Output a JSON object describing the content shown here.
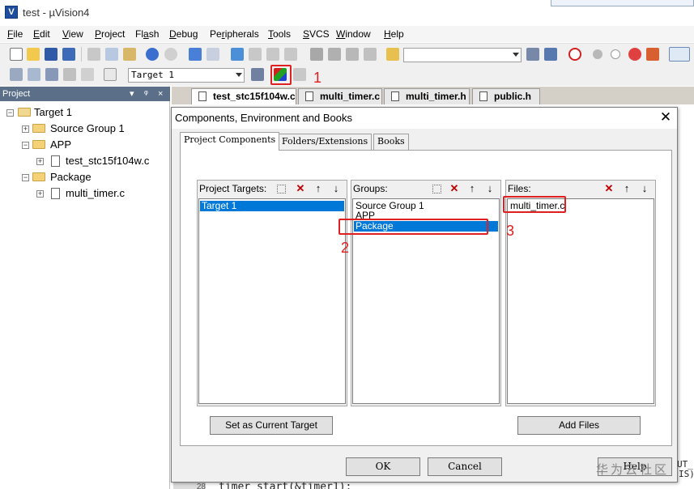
{
  "window": {
    "title": "test  - µVision4"
  },
  "menu": [
    {
      "label": "File",
      "key": "F",
      "rest": "ile"
    },
    {
      "label": "Edit",
      "key": "E",
      "rest": "dit"
    },
    {
      "label": "View",
      "key": "V",
      "rest": "iew"
    },
    {
      "label": "Project",
      "key": "P",
      "rest": "roject"
    },
    {
      "label": "Flash",
      "key": "",
      "pre": "Fl",
      "k2": "a",
      "rest": "sh"
    },
    {
      "label": "Debug",
      "key": "D",
      "rest": "ebug"
    },
    {
      "label": "Peripherals",
      "key": "",
      "pre": "Pe",
      "k2": "r",
      "rest": "ipherals"
    },
    {
      "label": "Tools",
      "key": "T",
      "rest": "ools"
    },
    {
      "label": "SVCS",
      "key": "S",
      "rest": "VCS"
    },
    {
      "label": "Window",
      "key": "W",
      "rest": "indow"
    },
    {
      "label": "Help",
      "key": "H",
      "rest": "elp"
    }
  ],
  "toolbar": {
    "target_select": "Target 1",
    "annotation_1": "1"
  },
  "project_panel": {
    "header": "Project",
    "tree": {
      "target": "Target 1",
      "source_group": "Source Group 1",
      "app": "APP",
      "app_file": "test_stc15f104w.c",
      "package": "Package",
      "package_file": "multi_timer.c"
    }
  },
  "editor_tabs": [
    {
      "label": "test_stc15f104w.c"
    },
    {
      "label": "multi_timer.c"
    },
    {
      "label": "multi_timer.h"
    },
    {
      "label": "public.h"
    }
  ],
  "editor": {
    "line_number": "28",
    "code_bottom": "timer_start(&timer1);",
    "code_right1": "UT_",
    "code_right2": "IS)"
  },
  "dialog": {
    "title": "Components, Environment and Books",
    "tabs": [
      "Project Components",
      "Folders/Extensions",
      "Books"
    ],
    "targets_label": "Project Targets:",
    "targets": [
      "Target 1"
    ],
    "groups_label": "Groups:",
    "groups": [
      "Source Group 1",
      "APP",
      "Package"
    ],
    "files_label": "Files:",
    "files": [
      "multi_timer.c"
    ],
    "set_target_button": "Set as Current Target",
    "add_files_button": "Add Files",
    "ok_button": "OK",
    "cancel_button": "Cancel",
    "help_button": "Help",
    "annotation_2": "2",
    "annotation_3": "3"
  },
  "watermark": "华为云社区",
  "colors": {
    "selection": "#0078d7",
    "annotation": "#e02020",
    "project_header": "#5b6f89"
  }
}
